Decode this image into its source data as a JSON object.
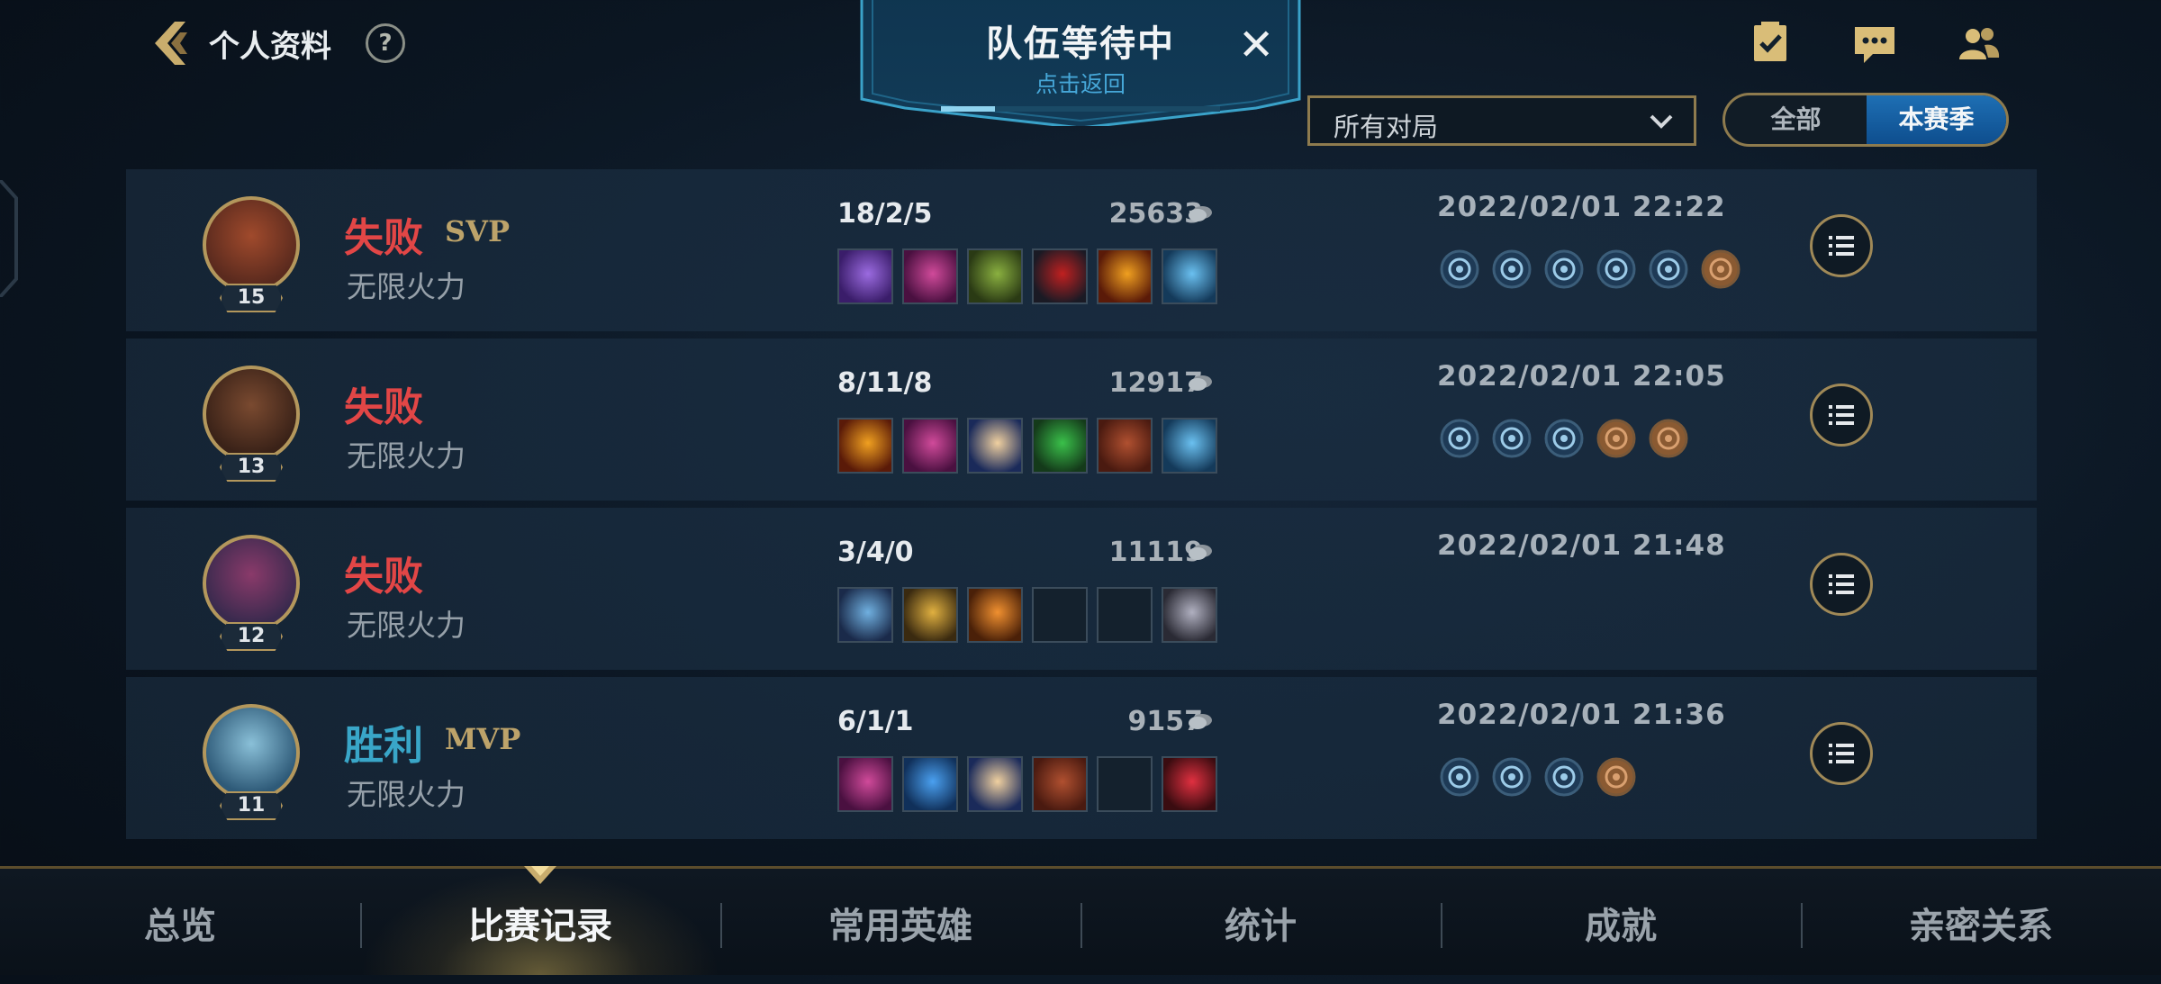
{
  "header": {
    "title": "个人资料",
    "help_label": "?",
    "back_icon": "back-chevron-icon"
  },
  "queue": {
    "title": "队伍等待中",
    "subtitle": "点击返回",
    "close_label": "✕"
  },
  "top_icons": [
    "checklist-icon",
    "chat-icon",
    "friends-icon"
  ],
  "filter": {
    "selected": "所有对局",
    "options": [
      "所有对局"
    ]
  },
  "season_toggle": {
    "all_label": "全部",
    "season_label": "本赛季",
    "active": "本赛季"
  },
  "matches": [
    {
      "result": "失败",
      "result_type": "lose",
      "badge": "SVP",
      "mode": "无限火力",
      "level": "15",
      "kda": "18/2/5",
      "gold": "25633",
      "date": "2022/02/01 22:22",
      "items": [
        "purple-sword",
        "violet-claw",
        "green-bow",
        "black-red-blade",
        "fire-blade",
        "blue-boots"
      ],
      "medals": [
        "blue",
        "blue",
        "blue",
        "blue",
        "blue",
        "bronze"
      ]
    },
    {
      "result": "失败",
      "result_type": "lose",
      "badge": "",
      "mode": "无限火力",
      "level": "13",
      "kda": "8/11/8",
      "gold": "12917",
      "date": "2022/02/01 22:05",
      "items": [
        "fire-blade",
        "violet-claw",
        "blue-orb",
        "green-orb",
        "red-book",
        "blue-boots"
      ],
      "medals": [
        "blue",
        "blue",
        "blue",
        "bronze",
        "bronze"
      ]
    },
    {
      "result": "失败",
      "result_type": "lose",
      "badge": "",
      "mode": "无限火力",
      "level": "12",
      "kda": "3/4/0",
      "gold": "11119",
      "date": "2022/02/01 21:48",
      "items": [
        "blue-axe",
        "gold-blade",
        "gold-staff",
        "empty",
        "empty",
        "grey-trinket"
      ],
      "medals": []
    },
    {
      "result": "胜利",
      "result_type": "win",
      "badge": "MVP",
      "mode": "无限火力",
      "level": "11",
      "kda": "6/1/1",
      "gold": "9157",
      "date": "2022/02/01 21:36",
      "items": [
        "violet-claw",
        "blue-blade",
        "blue-orb",
        "red-book",
        "empty",
        "red-boots"
      ],
      "medals": [
        "blue",
        "blue",
        "blue",
        "bronze"
      ]
    }
  ],
  "tabs": [
    "总览",
    "比赛记录",
    "常用英雄",
    "统计",
    "成就",
    "亲密关系"
  ],
  "active_tab": "比赛记录",
  "colors": {
    "lose": "#e24646",
    "win": "#39a6c8",
    "gold_accent": "#b3975c",
    "season_active": "#1e6fb4"
  }
}
